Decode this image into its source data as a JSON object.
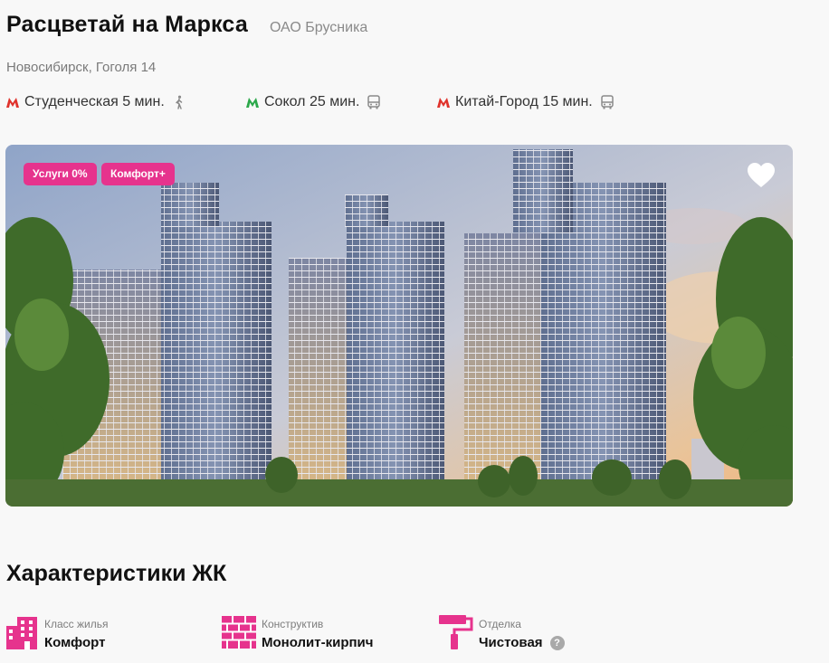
{
  "complex": {
    "title": "Расцветай на Маркса",
    "developer": "ОАО Брусника",
    "address": "Новосибирск, Гоголя 14"
  },
  "metro": [
    {
      "label": "Студенческая 5 мин.",
      "line_color": "#e0332c",
      "transport": "walk-icon"
    },
    {
      "label": "Сокол 25 мин.",
      "line_color": "#2ba84a",
      "transport": "bus-icon"
    },
    {
      "label": "Китай-Город 15 мин.",
      "line_color": "#e0332c",
      "transport": "bus-icon"
    }
  ],
  "hero": {
    "badges": [
      "Услуги 0%",
      "Комфорт+"
    ],
    "favorite_icon": "heart-icon"
  },
  "characteristics": {
    "title": "Характеристики ЖК",
    "items": [
      {
        "label": "Класс жилья",
        "value": "Комфорт",
        "icon": "building-icon"
      },
      {
        "label": "Конструктив",
        "value": "Монолит-кирпич",
        "icon": "brick-wall-icon"
      },
      {
        "label": "Отделка",
        "value": "Чистовая",
        "icon": "paint-roller-icon",
        "help": "?"
      }
    ]
  },
  "colors": {
    "accent": "#e6338d",
    "text": "#111111",
    "muted": "#7a7a7a"
  }
}
